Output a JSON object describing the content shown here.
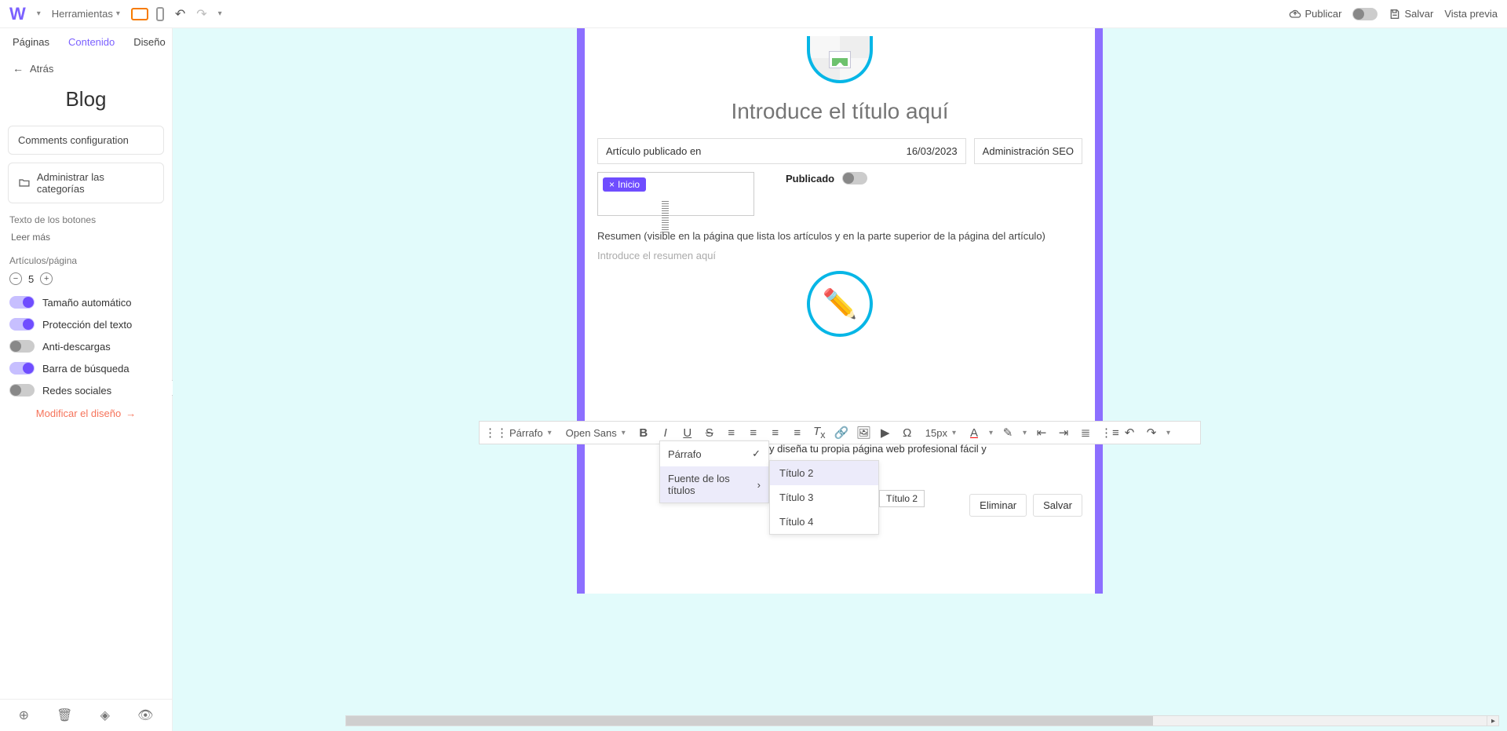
{
  "topbar": {
    "tools": "Herramientas",
    "publish": "Publicar",
    "save": "Salvar",
    "preview": "Vista previa"
  },
  "tabs": {
    "pages": "Páginas",
    "content": "Contenido",
    "design": "Diseño"
  },
  "back": "Atrás",
  "side_title": "Blog",
  "side": {
    "comments": "Comments configuration",
    "categories": "Administrar las categorías",
    "buttons_label": "Texto de los botones",
    "read_more": "Leer más",
    "articles_label": "Artículos/página",
    "articles_value": "5",
    "t_auto": "Tamaño automático",
    "t_protect": "Protección del texto",
    "t_anti": "Anti-descargas",
    "t_search": "Barra de búsqueda",
    "t_social": "Redes sociales",
    "modify": "Modificar el diseño"
  },
  "article": {
    "title_placeholder": "Introduce el título aquí",
    "pub_label": "Artículo publicado en",
    "pub_date": "16/03/2023",
    "seo": "Administración SEO",
    "tag_name": "Inicio",
    "published": "Publicado",
    "summary_label": "Resumen (visible en la página que lista los artículos y en la parte superior de la página del artículo)",
    "summary_ph": "Introduce el resumen aquí",
    "snippet": "y diseña tu propia página web profesional fácil y",
    "delete": "Eliminar",
    "save": "Salvar"
  },
  "rte": {
    "style_sel": "Párrafo",
    "font_sel": "Open Sans",
    "size_sel": "15px",
    "dd_paragraph": "Párrafo",
    "dd_titles": "Fuente de los títulos",
    "t2": "Título 2",
    "t3": "Título 3",
    "t4": "Título 4",
    "tooltip": "Título 2"
  }
}
